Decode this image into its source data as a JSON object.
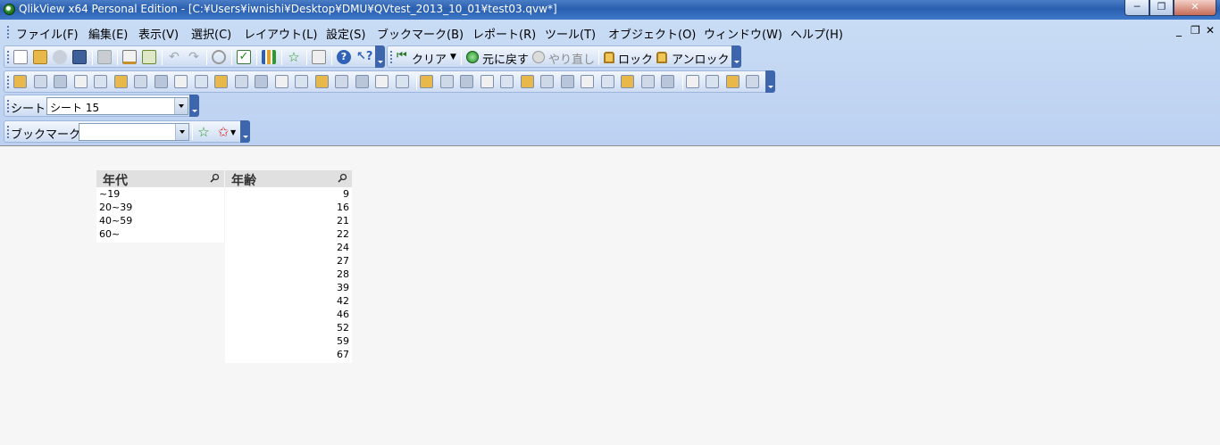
{
  "window": {
    "title": "QlikView x64 Personal Edition - [C:¥Users¥iwnishi¥Desktop¥DMU¥QVtest_2013_10_01¥test03.qvw*]",
    "min_glyph": "─",
    "max_glyph": "❐",
    "close_glyph": "✕"
  },
  "menu": {
    "items": [
      "ファイル(F)",
      "編集(E)",
      "表示(V)",
      "選択(C)",
      "レイアウト(L)",
      "設定(S)",
      "ブックマーク(B)",
      "レポート(R)",
      "ツール(T)",
      "オブジェクト(O)",
      "ウィンドウ(W)",
      "ヘルプ(H)"
    ],
    "mdi_min": "_",
    "mdi_restore": "❐",
    "mdi_close": "✕"
  },
  "toolbar_nav": {
    "clear_label": "クリア",
    "back_label": "元に戻す",
    "forward_label": "やり直し",
    "lock_label": "ロック",
    "unlock_label": "アンロック"
  },
  "sheet_bar": {
    "label": "シート",
    "selected": "シート 15"
  },
  "bookmark_bar": {
    "label": "ブックマーク",
    "selected": ""
  },
  "listboxes": {
    "nendai": {
      "title": "年代",
      "values": [
        "~19",
        "20~39",
        "40~59",
        "60~"
      ]
    },
    "nenrei": {
      "title": "年齢",
      "values": [
        "9",
        "16",
        "21",
        "22",
        "24",
        "27",
        "28",
        "39",
        "42",
        "46",
        "52",
        "59",
        "67"
      ]
    }
  },
  "icons": {
    "toolbar_standard": [
      "new-icon",
      "open-icon",
      "reload-icon",
      "save-icon",
      "print-icon",
      "edit-script-icon",
      "reload-data-icon",
      "undo-layout-icon",
      "redo-layout-icon",
      "search-icon",
      "select-fields-icon",
      "chart-wizard-icon",
      "bookmark-add-icon",
      "edit-icon",
      "help-icon",
      "whats-this-icon"
    ],
    "toolbar_design_count": 37
  },
  "colors": {
    "titlebar": "#2a5fb0",
    "chrome_bg": "#c9dcf5",
    "workspace_bg": "#f6f6f6",
    "listbox_header": "#e0e0e0"
  }
}
